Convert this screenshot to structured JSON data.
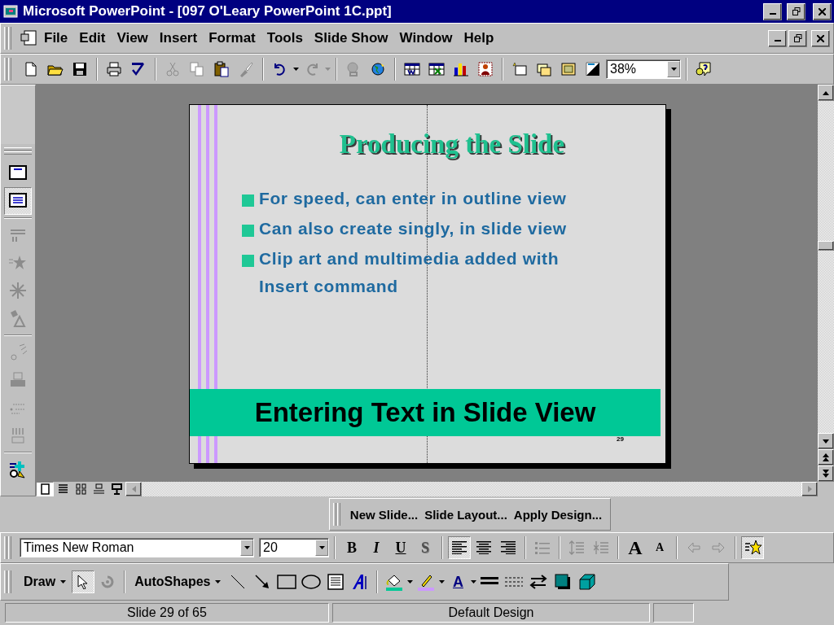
{
  "window": {
    "title": "Microsoft PowerPoint - [097 O'Leary PowerPoint 1C.ppt]"
  },
  "menu": [
    {
      "label": "File"
    },
    {
      "label": "Edit"
    },
    {
      "label": "View"
    },
    {
      "label": "Insert"
    },
    {
      "label": "Format"
    },
    {
      "label": "Tools"
    },
    {
      "label": "Slide Show"
    },
    {
      "label": "Window"
    },
    {
      "label": "Help"
    }
  ],
  "standard_toolbar": {
    "zoom": "38%"
  },
  "side_toolbar": {
    "views": [
      {
        "selected": false
      },
      {
        "selected": true
      }
    ]
  },
  "slide": {
    "title": "Producing the Slide",
    "bullets": [
      "For speed, can enter in outline view",
      "Can also create singly, in slide view",
      "Clip art and multimedia added with Insert command"
    ],
    "banner": "Entering Text in Slide View",
    "page_number": "29"
  },
  "view_buttons": [
    {
      "selected": true
    },
    {
      "selected": false
    },
    {
      "selected": false
    },
    {
      "selected": false
    },
    {
      "selected": false
    }
  ],
  "common_tasks": [
    "New Slide...",
    "Slide Layout...",
    "Apply Design..."
  ],
  "formatting_toolbar": {
    "font": "Times New Roman",
    "size": "20",
    "styles": [
      {
        "glyph": "B",
        "kind": "bold",
        "pressed": false
      },
      {
        "glyph": "I",
        "kind": "italic",
        "pressed": false
      },
      {
        "glyph": "U",
        "kind": "underline",
        "pressed": false
      },
      {
        "glyph": "S",
        "kind": "shadow",
        "pressed": false
      }
    ],
    "alignment": [
      {
        "selected": true
      },
      {
        "selected": false
      },
      {
        "selected": false
      }
    ],
    "font_size_glyphs": [
      "A",
      "A"
    ],
    "animation_effects": {
      "pressed": true
    }
  },
  "drawing_toolbar": {
    "draw": "Draw",
    "autoshapes": "AutoShapes",
    "font_color_glyph": "A"
  },
  "status_bar": [
    "Slide 29 of 65",
    "Default Design"
  ]
}
